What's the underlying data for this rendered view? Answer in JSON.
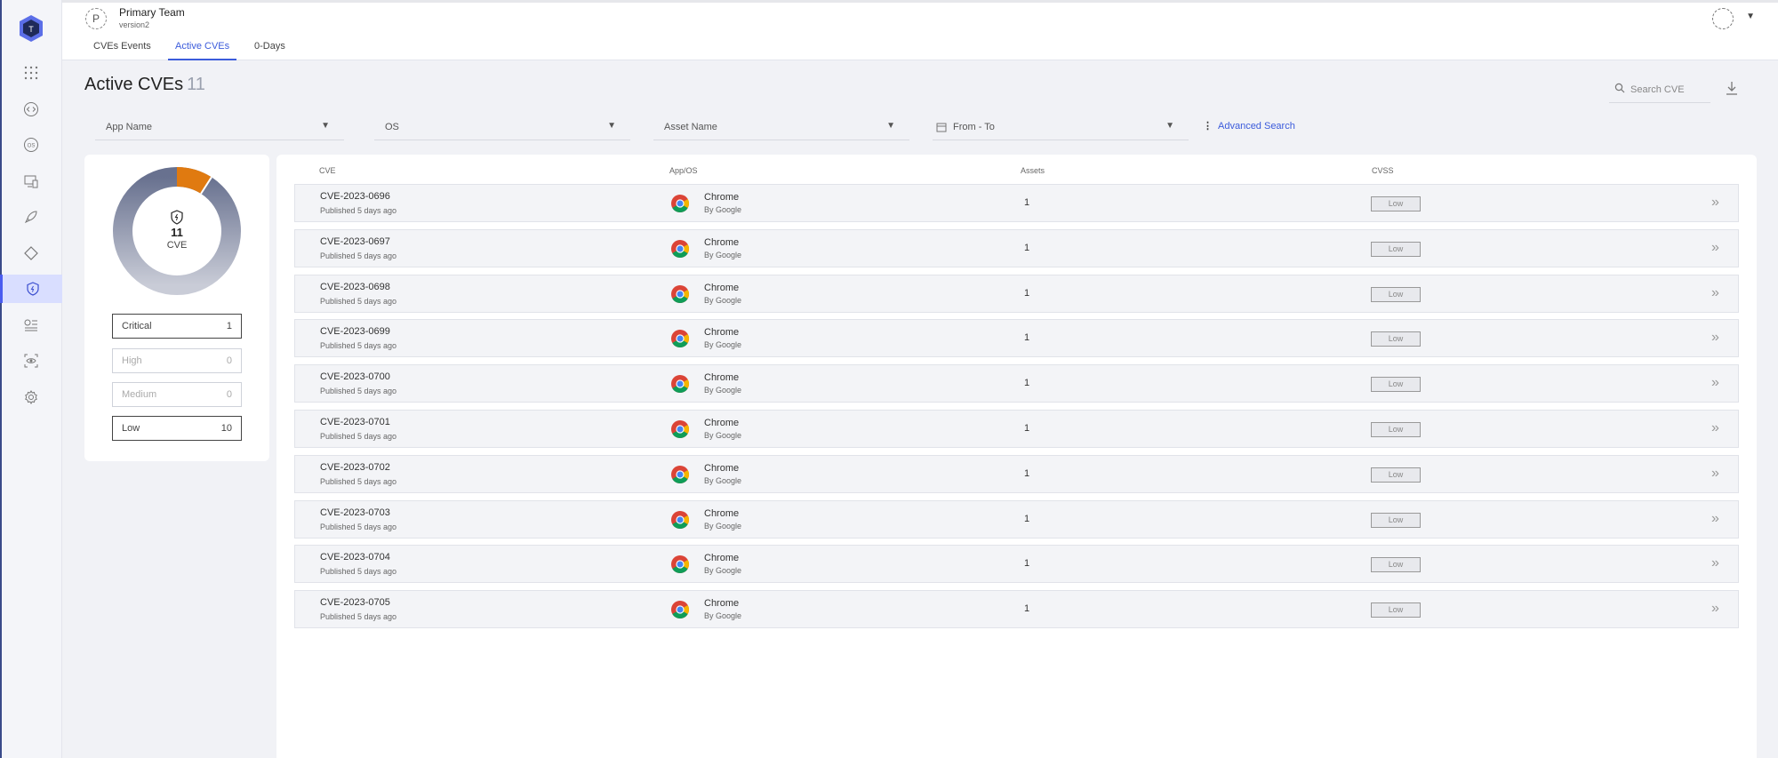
{
  "header": {
    "team_initial": "P",
    "team_name": "Primary Team",
    "team_sub": "version2"
  },
  "tabs": [
    {
      "label": "CVEs Events"
    },
    {
      "label": "Active CVEs"
    },
    {
      "label": "0-Days"
    }
  ],
  "page": {
    "title": "Active CVEs",
    "count": "11"
  },
  "search": {
    "placeholder": "Search CVE"
  },
  "filters": {
    "app_name": "App Name",
    "os": "OS",
    "asset_name": "Asset Name",
    "date_range": "From - To",
    "advanced": "Advanced Search"
  },
  "summary": {
    "total": "11",
    "total_label": "CVE",
    "severities": [
      {
        "name": "Critical",
        "count": "1"
      },
      {
        "name": "High",
        "count": "0"
      },
      {
        "name": "Medium",
        "count": "0"
      },
      {
        "name": "Low",
        "count": "10"
      }
    ],
    "colors": {
      "critical": "#e07a10",
      "low": "#6b7591"
    }
  },
  "table": {
    "headers": [
      "CVE",
      "App/OS",
      "Assets",
      "CVSS"
    ],
    "rows": [
      {
        "cve": "CVE-2023-0696",
        "published": "Published 5 days ago",
        "app": "Chrome",
        "vendor": "By Google",
        "assets": "1",
        "cvss": "Low"
      },
      {
        "cve": "CVE-2023-0697",
        "published": "Published 5 days ago",
        "app": "Chrome",
        "vendor": "By Google",
        "assets": "1",
        "cvss": "Low"
      },
      {
        "cve": "CVE-2023-0698",
        "published": "Published 5 days ago",
        "app": "Chrome",
        "vendor": "By Google",
        "assets": "1",
        "cvss": "Low"
      },
      {
        "cve": "CVE-2023-0699",
        "published": "Published 5 days ago",
        "app": "Chrome",
        "vendor": "By Google",
        "assets": "1",
        "cvss": "Low"
      },
      {
        "cve": "CVE-2023-0700",
        "published": "Published 5 days ago",
        "app": "Chrome",
        "vendor": "By Google",
        "assets": "1",
        "cvss": "Low"
      },
      {
        "cve": "CVE-2023-0701",
        "published": "Published 5 days ago",
        "app": "Chrome",
        "vendor": "By Google",
        "assets": "1",
        "cvss": "Low"
      },
      {
        "cve": "CVE-2023-0702",
        "published": "Published 5 days ago",
        "app": "Chrome",
        "vendor": "By Google",
        "assets": "1",
        "cvss": "Low"
      },
      {
        "cve": "CVE-2023-0703",
        "published": "Published 5 days ago",
        "app": "Chrome",
        "vendor": "By Google",
        "assets": "1",
        "cvss": "Low"
      },
      {
        "cve": "CVE-2023-0704",
        "published": "Published 5 days ago",
        "app": "Chrome",
        "vendor": "By Google",
        "assets": "1",
        "cvss": "Low"
      },
      {
        "cve": "CVE-2023-0705",
        "published": "Published 5 days ago",
        "app": "Chrome",
        "vendor": "By Google",
        "assets": "1",
        "cvss": "Low"
      }
    ]
  },
  "sidebar": {
    "icons": [
      "apps-grid-icon",
      "code-icon",
      "os-icon",
      "devices-icon",
      "rocket-icon",
      "diamond-icon",
      "shield-icon",
      "policy-list-icon",
      "eye-scan-icon",
      "gear-icon"
    ],
    "active": "shield-icon"
  }
}
